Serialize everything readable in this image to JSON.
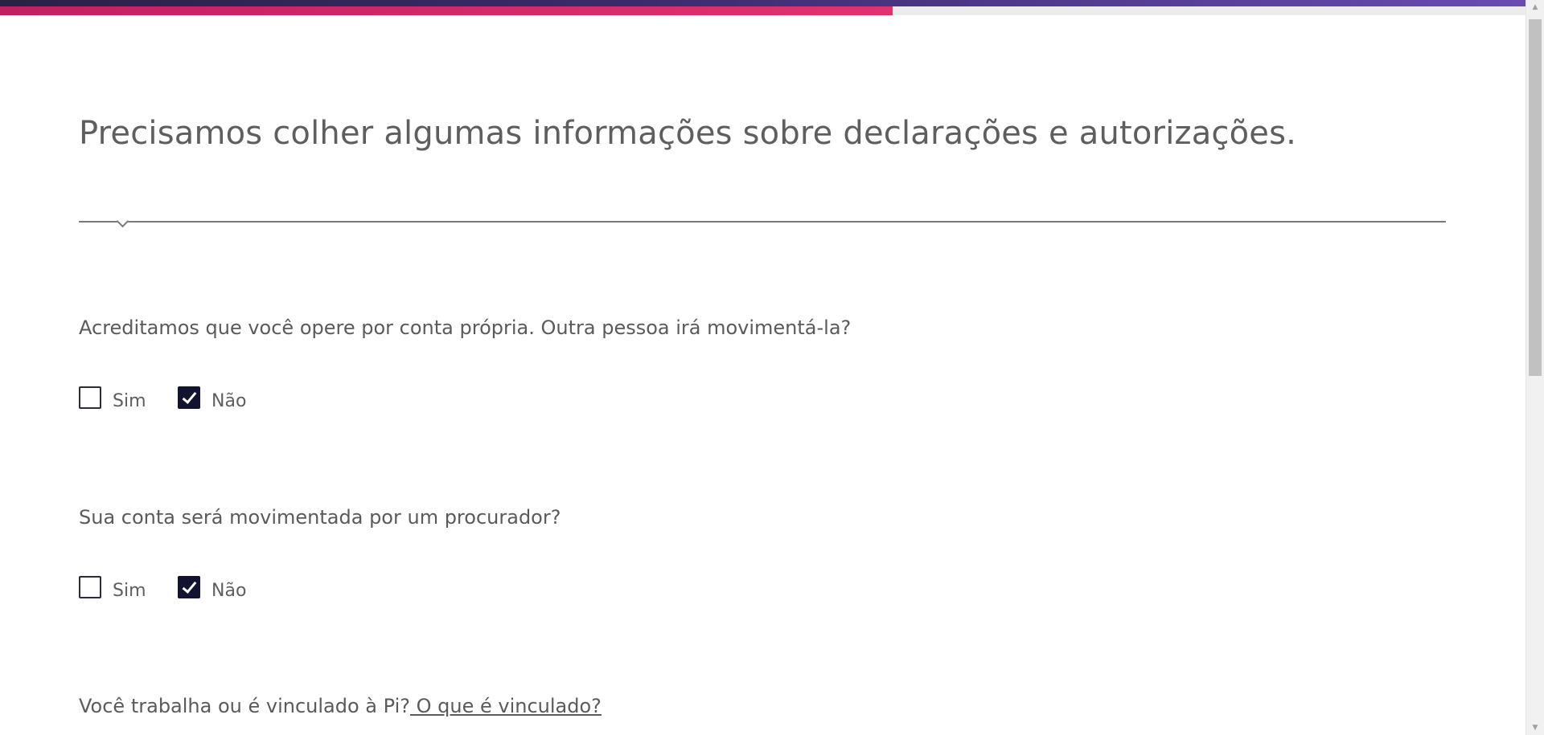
{
  "progress": {
    "value": 0.585
  },
  "page": {
    "title": "Precisamos colher algumas informações sobre declarações e autorizações."
  },
  "questions": [
    {
      "text": "Acreditamos que você opere por conta própria. Outra pessoa irá movimentá-la?",
      "options": [
        {
          "label": "Sim",
          "checked": false
        },
        {
          "label": "Não",
          "checked": true
        }
      ]
    },
    {
      "text": "Sua conta será movimentada por um procurador?",
      "options": [
        {
          "label": "Sim",
          "checked": false
        },
        {
          "label": "Não",
          "checked": true
        }
      ]
    },
    {
      "text": "Você trabalha ou é vinculado à Pi?",
      "link": " O que é vinculado?"
    }
  ],
  "colors": {
    "accent": "#e2316f",
    "brand_dark": "#121330",
    "text": "#5a5a5a"
  },
  "icons": {
    "checkbox_checked": "check-icon",
    "scroll_up": "triangle-up-icon",
    "scroll_down": "triangle-down-icon"
  }
}
